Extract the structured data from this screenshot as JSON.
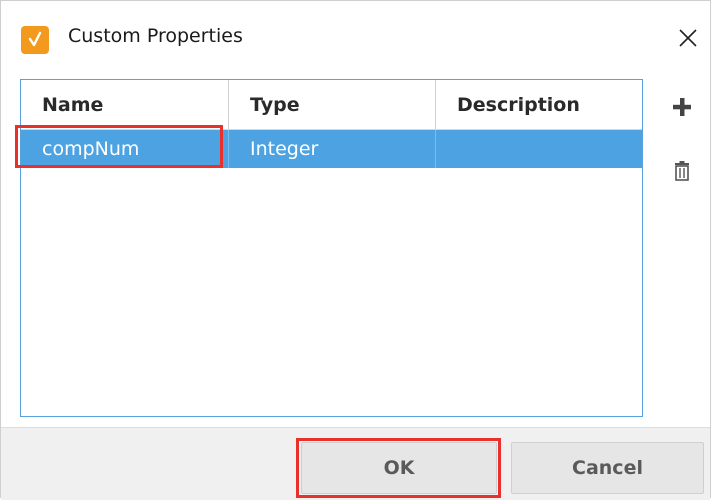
{
  "window": {
    "title": "Custom Properties",
    "app_icon": "ignition-property-icon",
    "close_icon": "close-icon"
  },
  "table": {
    "columns": [
      "Name",
      "Type",
      "Description"
    ],
    "rows": [
      {
        "name": "compNum",
        "type": "Integer",
        "description": ""
      }
    ],
    "selected_row": 0
  },
  "tools": {
    "add_icon": "plus-icon",
    "delete_icon": "trash-icon"
  },
  "buttons": {
    "ok": "OK",
    "cancel": "Cancel"
  },
  "colors": {
    "selection": "#4da3e2",
    "highlight": "#e8302c",
    "app_icon": "#f39a1e"
  }
}
